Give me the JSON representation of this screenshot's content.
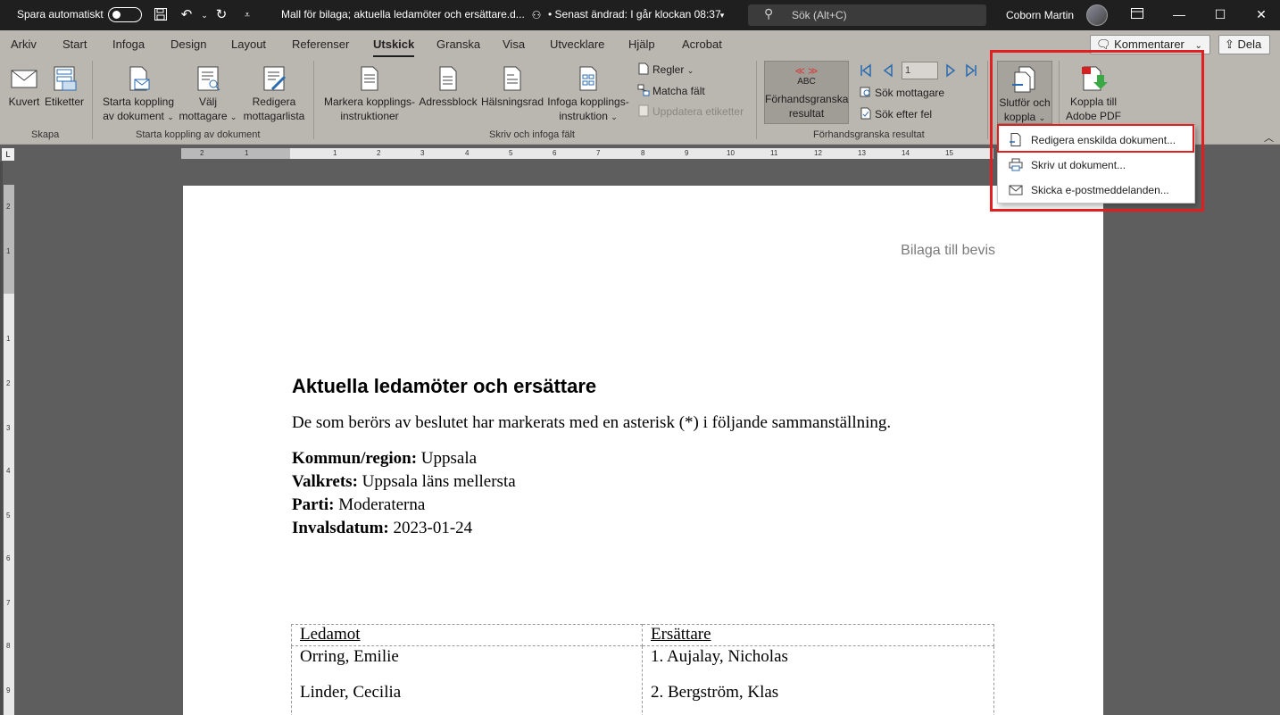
{
  "titlebar": {
    "autosave_label": "Spara automatiskt",
    "document_title": "Mall för bilaga; aktuella ledamöter och ersättare.d...",
    "modified": "• Senast ändrad: I går klockan 08:37",
    "search_placeholder": "Sök (Alt+C)",
    "user_name": "Coborn Martin"
  },
  "tabs": [
    "Arkiv",
    "Start",
    "Infoga",
    "Design",
    "Layout",
    "Referenser",
    "Utskick",
    "Granska",
    "Visa",
    "Utvecklare",
    "Hjälp",
    "Acrobat"
  ],
  "active_tab": "Utskick",
  "actions": {
    "comments_label": "Kommentarer",
    "share_label": "Dela"
  },
  "ribbon": {
    "group_skapa": {
      "label": "Skapa",
      "kuvert": "Kuvert",
      "etiketter": "Etiketter"
    },
    "group_starta": {
      "label": "Starta koppling av dokument",
      "starta_line1": "Starta koppling",
      "starta_line2": "av dokument",
      "valj_line1": "Välj",
      "valj_line2": "mottagare",
      "redigera_line1": "Redigera",
      "redigera_line2": "mottagarlista"
    },
    "group_skriv": {
      "label": "Skriv och infoga fält",
      "markera_line1": "Markera kopplings-",
      "markera_line2": "instruktioner",
      "adressblock": "Adressblock",
      "halsningsrad": "Hälsningsrad",
      "infoga_line1": "Infoga kopplings-",
      "infoga_line2": "instruktion",
      "regler": "Regler",
      "matcha": "Matcha fält",
      "uppdatera": "Uppdatera etiketter"
    },
    "group_forhand": {
      "label": "Förhandsgranska resultat",
      "preview_abc": "ABC",
      "preview_line1": "Förhandsgranska",
      "preview_line2": "resultat",
      "record_value": "1",
      "sok_mottagare": "Sök mottagare",
      "sok_fel": "Sök efter fel"
    },
    "group_slutfor": {
      "slutfor_line1": "Slutför och",
      "slutfor_line2": "koppla",
      "adobe_line1": "Koppla till",
      "adobe_line2": "Adobe PDF"
    }
  },
  "dropdown": {
    "items": [
      {
        "label": "Redigera enskilda dokument..."
      },
      {
        "label": "Skriv ut dokument..."
      },
      {
        "label": "Skicka e-postmeddelanden..."
      }
    ]
  },
  "document": {
    "header": "Bilaga till bevis",
    "title": "Aktuella ledamöter och ersättare",
    "intro": "De som berörs av beslutet har markerats med en asterisk (*) i följande sammanställning.",
    "fields": [
      {
        "key": "Kommun/region:",
        "value": " Uppsala"
      },
      {
        "key": "Valkrets:",
        "value": " Uppsala läns mellersta"
      },
      {
        "key": "Parti:",
        "value": " Moderaterna"
      },
      {
        "key": "Invalsdatum:",
        "value": " 2023-01-24"
      }
    ],
    "table": {
      "headers": [
        "Ledamot",
        "Ersättare"
      ],
      "ledamot": [
        "Orring, Emilie",
        "Linder, Cecilia"
      ],
      "ersattare": [
        "1. Aujalay, Nicholas",
        "2. Bergström, Klas"
      ]
    }
  },
  "colors": {
    "ribbon_bg": "#bab6b0",
    "titlebar_bg": "#1f1f1f",
    "highlight": "#e02020"
  }
}
